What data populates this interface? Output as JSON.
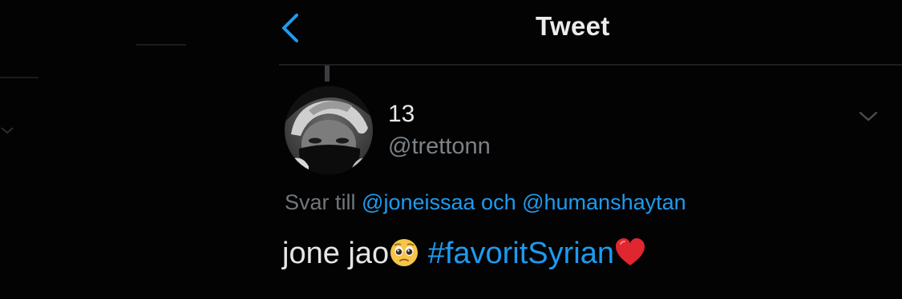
{
  "header": {
    "title": "Tweet",
    "back_icon": "chevron-left-icon"
  },
  "tweet": {
    "author": {
      "display_name": "13",
      "handle": "@trettonn"
    },
    "reply_to": {
      "prefix": "Svar till",
      "mention_1": "@joneissaa",
      "conjunction": "och",
      "mention_2": "@humanshaytan"
    },
    "text_before": "jone jao",
    "emoji_1": "pleading-face-emoji",
    "hashtag": "#favoritSyrian",
    "emoji_2": "red-heart-emoji",
    "more_icon": "chevron-down-icon"
  },
  "colors": {
    "background": "#030304",
    "accent": "#1d9bf0",
    "secondary_text": "#7d8286",
    "primary_text": "#e7e9ea"
  }
}
